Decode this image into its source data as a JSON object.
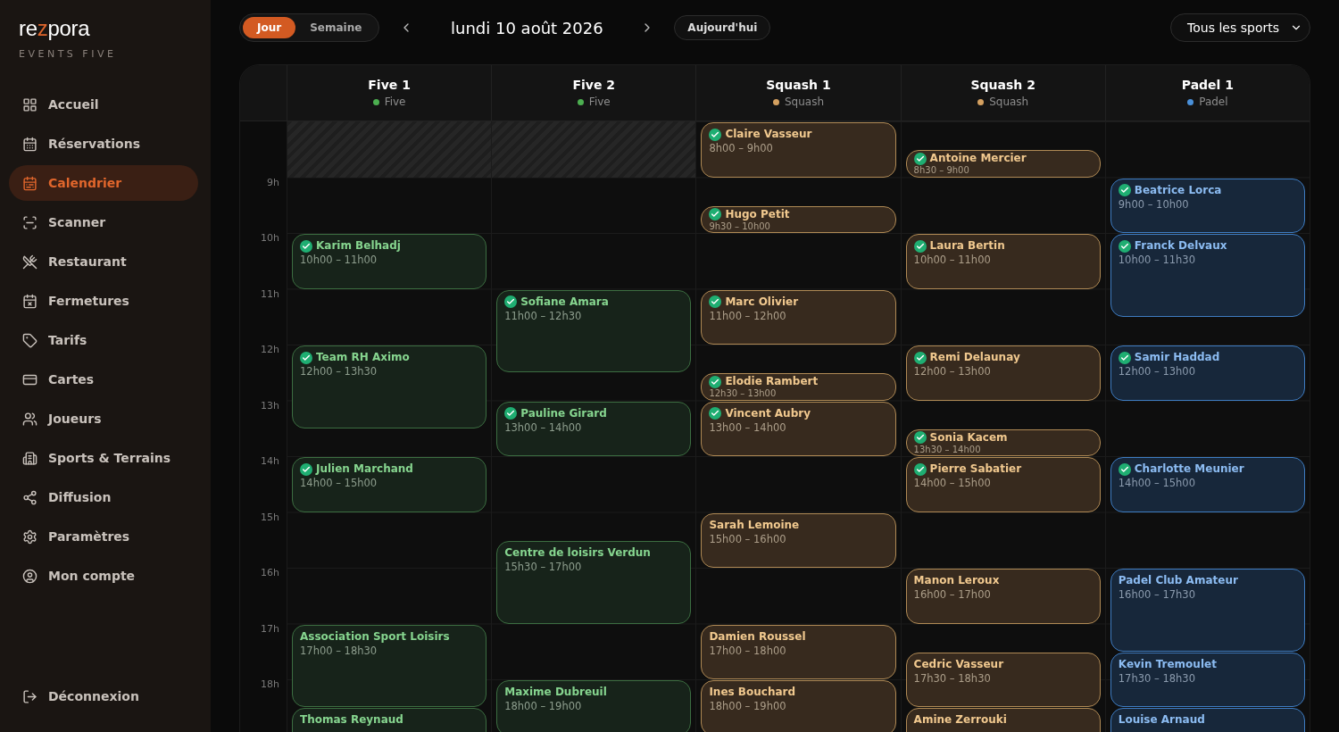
{
  "brand": {
    "logo": [
      {
        "text": "re",
        "accent": false
      },
      {
        "text": "z",
        "accent": true
      },
      {
        "text": "pora",
        "accent": false
      }
    ],
    "subtitle": "EVENTS FIVE"
  },
  "sidebar": {
    "items": [
      {
        "label": "Accueil",
        "selected": false
      },
      {
        "label": "Réservations",
        "selected": false
      },
      {
        "label": "Calendrier",
        "selected": true
      },
      {
        "label": "Scanner",
        "selected": false
      },
      {
        "label": "Restaurant",
        "selected": false
      },
      {
        "label": "Fermetures",
        "selected": false
      },
      {
        "label": "Tarifs",
        "selected": false
      },
      {
        "label": "Cartes",
        "selected": false
      },
      {
        "label": "Joueurs",
        "selected": false
      },
      {
        "label": "Sports & Terrains",
        "selected": false
      },
      {
        "label": "Diffusion",
        "selected": false
      },
      {
        "label": "Paramètres",
        "selected": false
      },
      {
        "label": "Mon compte",
        "selected": false
      }
    ],
    "logout": "Déconnexion"
  },
  "toolbar": {
    "views": [
      {
        "label": "Jour",
        "selected": true
      },
      {
        "label": "Semaine",
        "selected": false
      }
    ],
    "date": "lundi 10 août 2026",
    "today": "Aujourd'hui",
    "sport_filter": "Tous les sports"
  },
  "hours": [
    "9h",
    "10h",
    "11h",
    "12h",
    "13h",
    "14h",
    "15h",
    "16h",
    "17h",
    "18h"
  ],
  "columns": [
    {
      "name": "Five 1",
      "sport": "Five",
      "kind": "five",
      "color": "#4caf50",
      "blocked_first_hour": true,
      "events": [
        {
          "name": "Karim Belhadj",
          "time": "10h00 – 11h00",
          "confirmed": true
        },
        {
          "name": "Team RH Aximo",
          "time": "12h00 – 13h30",
          "confirmed": true
        },
        {
          "name": "Julien Marchand",
          "time": "14h00 – 15h00",
          "confirmed": true
        },
        {
          "name": "Association Sport Loisirs",
          "time": "17h00 – 18h30",
          "confirmed": false
        },
        {
          "name": "Thomas Reynaud",
          "confirmed": false
        }
      ]
    },
    {
      "name": "Five 2",
      "sport": "Five",
      "kind": "five",
      "color": "#4caf50",
      "blocked_first_hour": true,
      "events": [
        {
          "name": "Sofiane Amara",
          "time": "11h00 – 12h30",
          "confirmed": true
        },
        {
          "name": "Pauline Girard",
          "time": "13h00 – 14h00",
          "confirmed": true
        },
        {
          "name": "Centre de loisirs Verdun",
          "time": "15h30 – 17h00",
          "confirmed": false
        },
        {
          "name": "Maxime Dubreuil",
          "time": "18h00 – 19h00",
          "confirmed": false
        }
      ]
    },
    {
      "name": "Squash 1",
      "sport": "Squash",
      "kind": "squash",
      "color": "#d4a060",
      "blocked_first_hour": false,
      "events": [
        {
          "name": "Claire Vasseur",
          "time": "8h00 – 9h00",
          "confirmed": true
        },
        {
          "name": "Hugo Petit",
          "time": "9h30 – 10h00",
          "confirmed": true
        },
        {
          "name": "Marc Olivier",
          "time": "11h00 – 12h00",
          "confirmed": true
        },
        {
          "name": "Elodie Rambert",
          "time": "12h30 – 13h00",
          "confirmed": true
        },
        {
          "name": "Vincent Aubry",
          "time": "13h00 – 14h00",
          "confirmed": true
        },
        {
          "name": "Sarah Lemoine",
          "time": "15h00 – 16h00",
          "confirmed": false
        },
        {
          "name": "Damien Roussel",
          "time": "17h00 – 18h00",
          "confirmed": false
        },
        {
          "name": "Ines Bouchard",
          "time": "18h00 – 19h00",
          "confirmed": false
        }
      ]
    },
    {
      "name": "Squash 2",
      "sport": "Squash",
      "kind": "squash",
      "color": "#d4a060",
      "blocked_first_hour": false,
      "events": [
        {
          "name": "Antoine Mercier",
          "time": "8h30 – 9h00",
          "confirmed": true
        },
        {
          "name": "Laura Bertin",
          "time": "10h00 – 11h00",
          "confirmed": true
        },
        {
          "name": "Remi Delaunay",
          "time": "12h00 – 13h00",
          "confirmed": true
        },
        {
          "name": "Sonia Kacem",
          "time": "13h30 – 14h00",
          "confirmed": true
        },
        {
          "name": "Pierre Sabatier",
          "time": "14h00 – 15h00",
          "confirmed": true
        },
        {
          "name": "Manon Leroux",
          "time": "16h00 – 17h00",
          "confirmed": false
        },
        {
          "name": "Cedric Vasseur",
          "time": "17h30 – 18h30",
          "confirmed": false
        },
        {
          "name": "Amine Zerrouki",
          "confirmed": false
        }
      ]
    },
    {
      "name": "Padel 1",
      "sport": "Padel",
      "kind": "padel",
      "color": "#4a90d9",
      "blocked_first_hour": false,
      "events": [
        {
          "name": "Beatrice Lorca",
          "time": "9h00 – 10h00",
          "confirmed": true
        },
        {
          "name": "Franck Delvaux",
          "time": "10h00 – 11h30",
          "confirmed": true
        },
        {
          "name": "Samir Haddad",
          "time": "12h00 – 13h00",
          "confirmed": true
        },
        {
          "name": "Charlotte Meunier",
          "time": "14h00 – 15h00",
          "confirmed": true
        },
        {
          "name": "Padel Club Amateur",
          "time": "16h00 – 17h30",
          "confirmed": false
        },
        {
          "name": "Kevin Tremoulet",
          "time": "17h30 – 18h30",
          "confirmed": false
        },
        {
          "name": "Louise Arnaud",
          "confirmed": false
        }
      ]
    }
  ]
}
